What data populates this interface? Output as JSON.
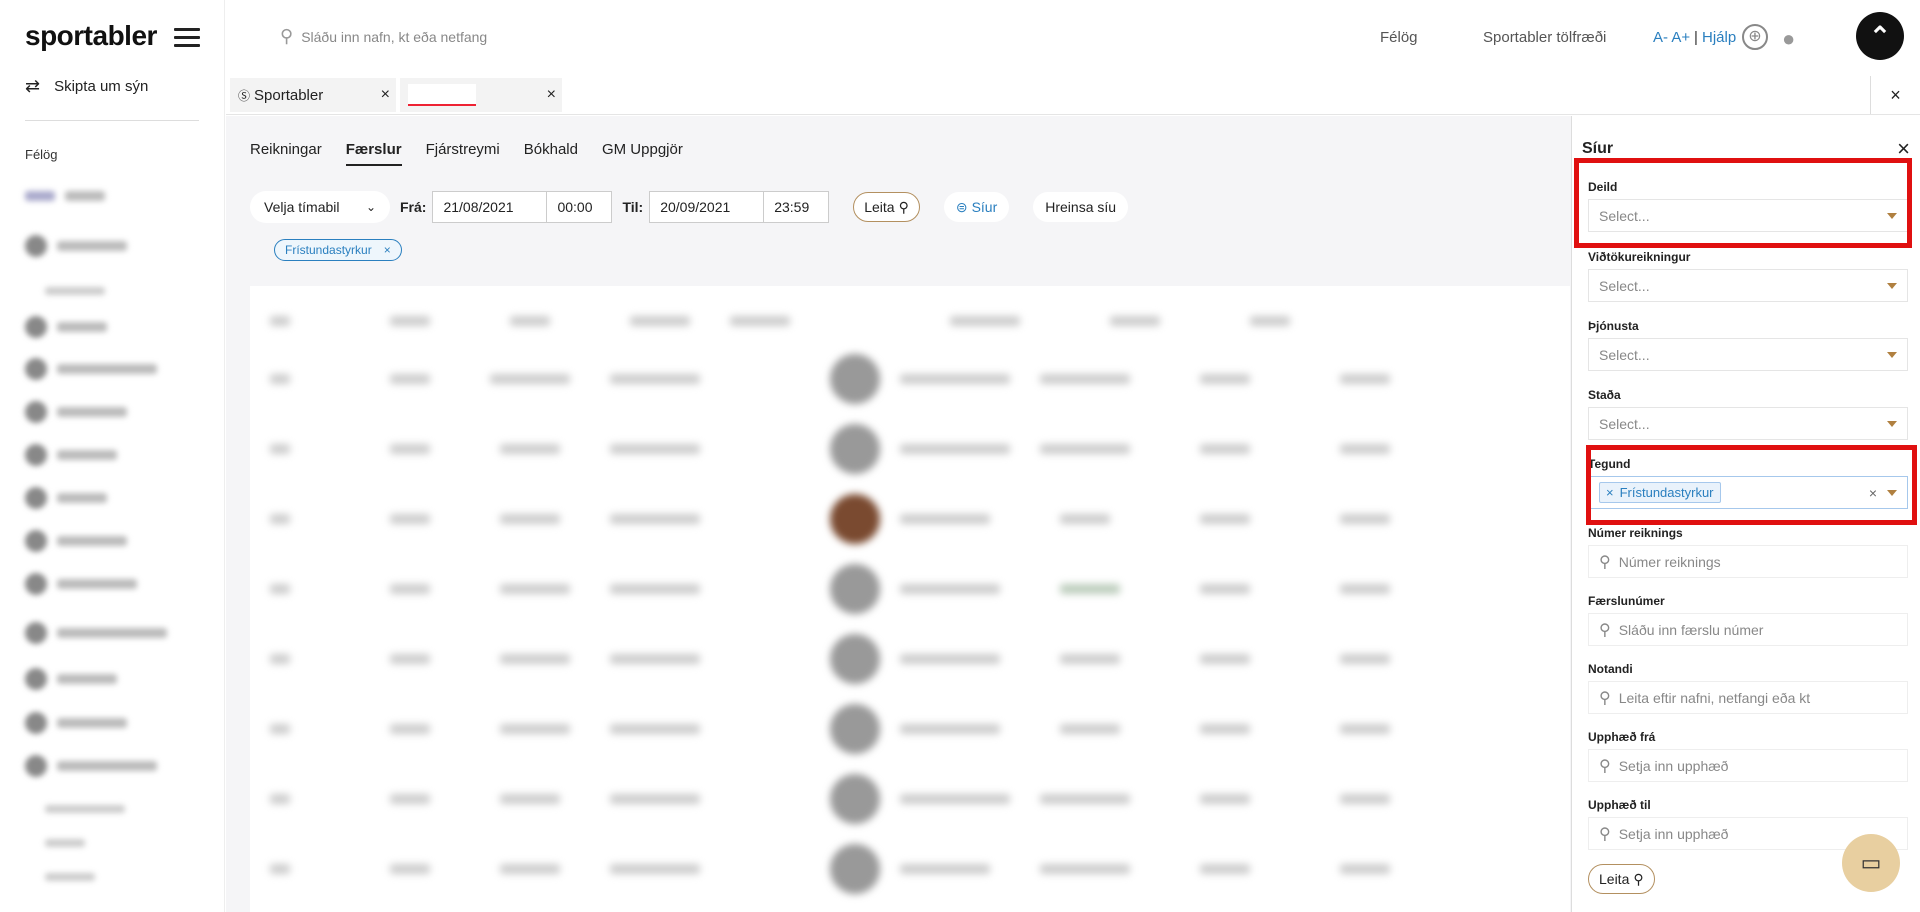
{
  "sidebar": {
    "logo": "sportabler",
    "switch_view": "Skipta um sýn",
    "section_label": "Félög"
  },
  "topbar": {
    "search_placeholder": "Sláðu inn nafn, kt eða netfang",
    "link_clubs": "Félög",
    "link_stats": "Sportabler tölfræði",
    "font_size": "A- A+",
    "separator": "|",
    "help": "Hjálp"
  },
  "tabs": {
    "tab1_label": "Sportabler",
    "close": "×"
  },
  "subnav": [
    "Reikningar",
    "Færslur",
    "Fjárstreymi",
    "Bókhald",
    "GM Uppgjör"
  ],
  "filters": {
    "period_select": "Velja tímabil",
    "from_label": "Frá:",
    "from_date": "21/08/2021",
    "from_time": "00:00",
    "to_label": "Til:",
    "to_date": "20/09/2021",
    "to_time": "23:59",
    "search_button": "Leita",
    "filters_button": "Síur",
    "clear_button": "Hreinsa síu",
    "active_chip": "Frístundastyrkur"
  },
  "panel": {
    "title": "Síur",
    "deild_label": "Deild",
    "deild_value": "Select...",
    "vidtoku_label": "Viðtökureikningur",
    "vidtoku_value": "Select...",
    "thjonusta_label": "Þjónusta",
    "thjonusta_value": "Select...",
    "stada_label": "Staða",
    "stada_value": "Select...",
    "tegund_label": "Tegund",
    "tegund_chip": "Frístundastyrkur",
    "numer_label": "Númer reiknings",
    "numer_placeholder": "Númer reiknings",
    "faerslu_label": "Færslunúmer",
    "faerslu_placeholder": "Sláðu inn færslu númer",
    "notandi_label": "Notandi",
    "notandi_placeholder": "Leita eftir nafni, netfangi eða kt",
    "upphaed_fra_label": "Upphæð frá",
    "upphaed_fra_placeholder": "Setja inn upphæð",
    "upphaed_til_label": "Upphæð til",
    "upphaed_til_placeholder": "Setja inn upphæð",
    "search_button": "Leita"
  },
  "colors": {
    "accent_blue": "#2a7fbf",
    "highlight_red": "#e01010",
    "gold": "#b39060"
  }
}
